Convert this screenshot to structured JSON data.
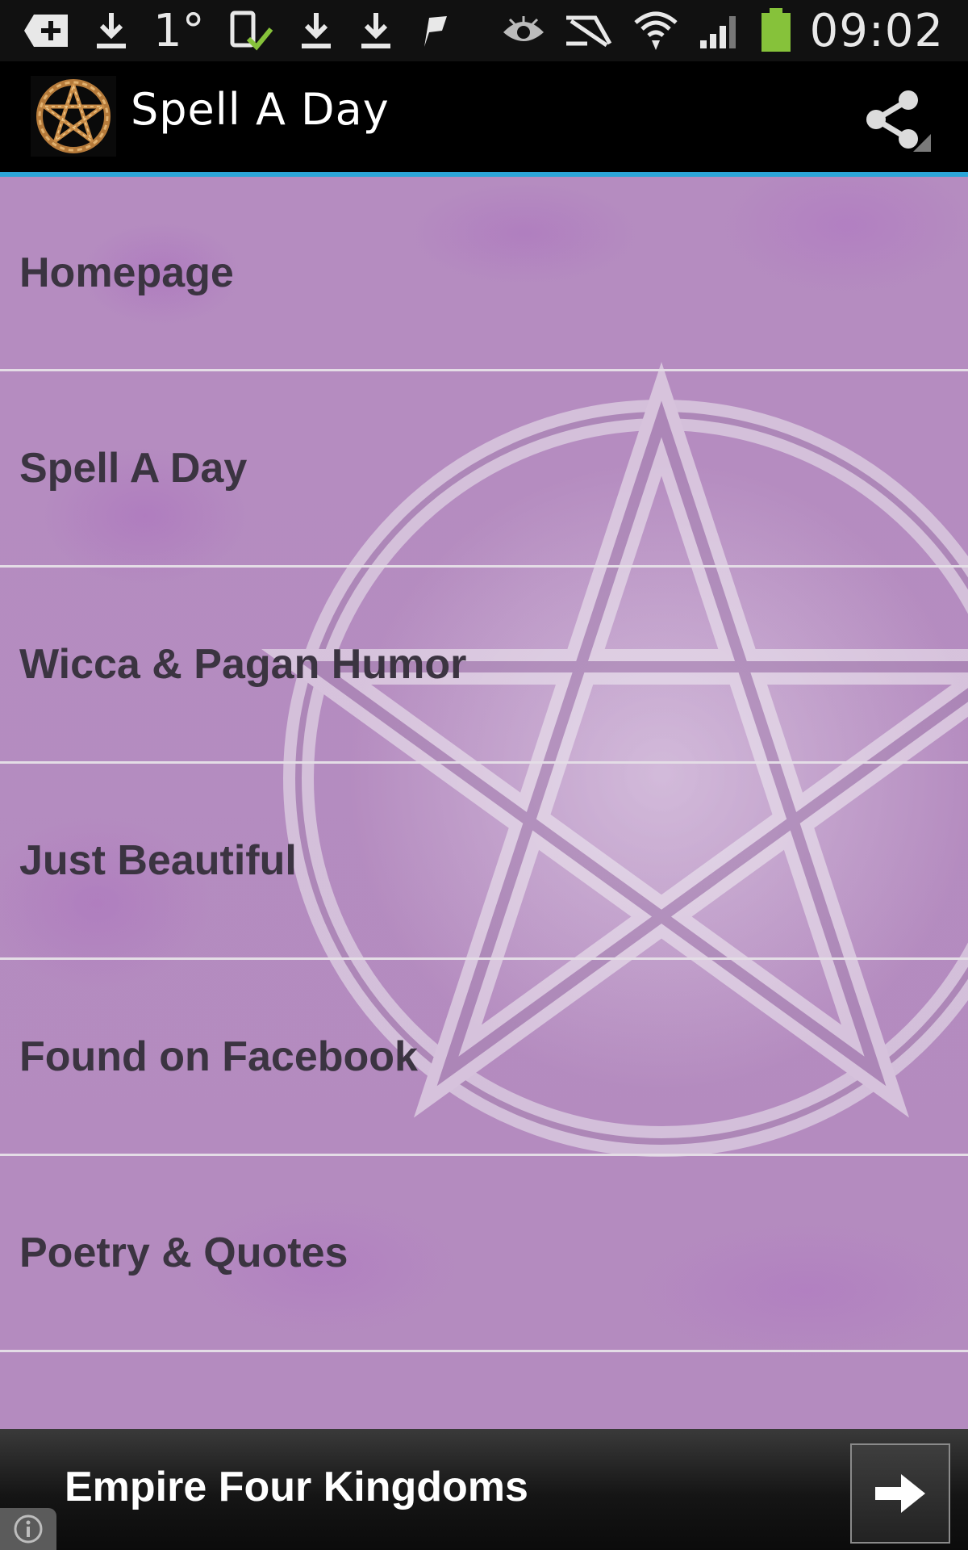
{
  "status_bar": {
    "icons_left": [
      "add-notification-icon",
      "download-icon",
      "temperature-text",
      "device-check-icon",
      "download-icon",
      "download-icon",
      "flag-icon"
    ],
    "temperature": "1°",
    "icons_right": [
      "eye-icon",
      "mute-icon",
      "wifi-icon",
      "signal-icon",
      "battery-icon"
    ],
    "time": "09:02"
  },
  "action_bar": {
    "title": "Spell A Day",
    "accent_color": "#2ca5d8",
    "share_icon": "share-icon"
  },
  "menu": {
    "items": [
      {
        "label": "Homepage"
      },
      {
        "label": "Spell A Day"
      },
      {
        "label": "Wicca & Pagan Humor"
      },
      {
        "label": "Just Beautiful"
      },
      {
        "label": "Found on Facebook"
      },
      {
        "label": "Poetry & Quotes"
      }
    ]
  },
  "ad": {
    "text": "Empire Four Kingdoms",
    "button_icon": "arrow-right-icon",
    "info_icon": "info-icon"
  },
  "colors": {
    "background_purple": "#b58cc0",
    "menu_text": "#3b3441",
    "divider": "#e4dde6"
  }
}
